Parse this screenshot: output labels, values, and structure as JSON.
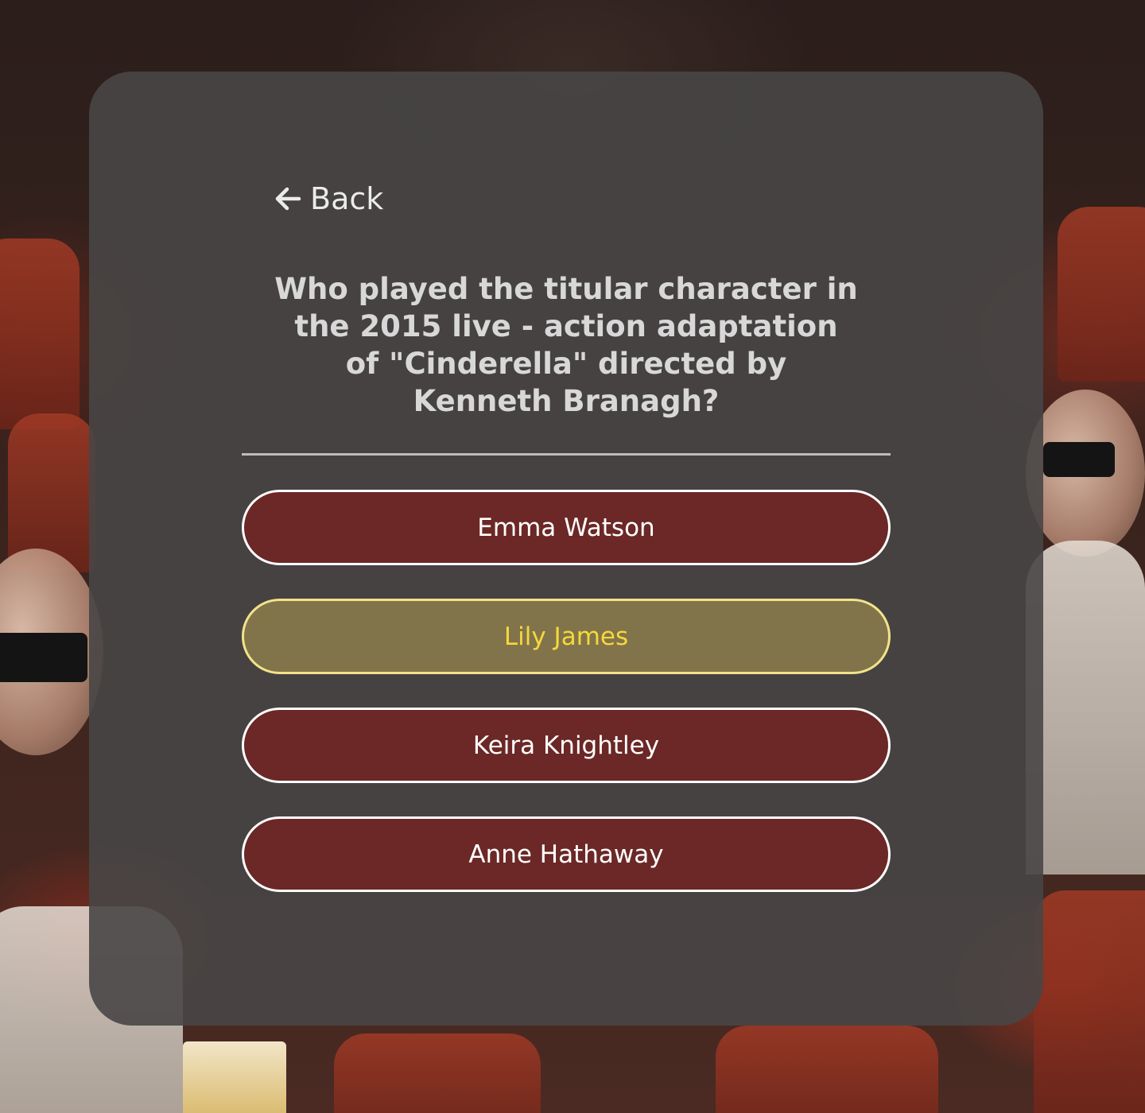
{
  "nav": {
    "back_label": "Back",
    "back_icon": "arrow-left-icon"
  },
  "quiz": {
    "question": "Who played the titular character in the 2015 live - action adaptation of \"Cinderella\" directed by Kenneth Branagh?",
    "answers": [
      {
        "label": "Emma Watson",
        "selected": false
      },
      {
        "label": "Lily James",
        "selected": true
      },
      {
        "label": "Keira Knightley",
        "selected": false
      },
      {
        "label": "Anne Hathaway",
        "selected": false
      }
    ]
  },
  "colors": {
    "card_background": "#484646",
    "answer_background": "#6b2826",
    "answer_border": "#ffffff",
    "selected_background": "#82744a",
    "selected_border": "#f2e38a",
    "selected_text": "#f5d83c"
  }
}
